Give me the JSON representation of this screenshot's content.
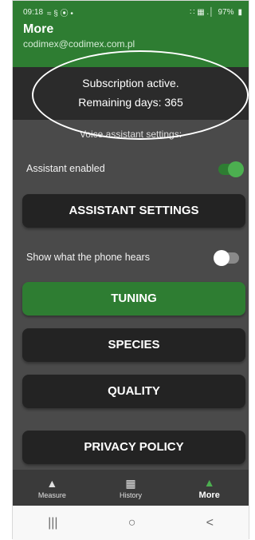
{
  "status_bar": {
    "time": "09:18",
    "left_icons": "≈ § ⦿ •",
    "right_icons": "∷ ▦ .│",
    "battery": "97%"
  },
  "header": {
    "title": "More",
    "email": "codimex@codimex.com.pl"
  },
  "subscription": {
    "line1": "Subscription active.",
    "line2": "Remaining days: 365"
  },
  "voice_section": {
    "label": "Voice assistant settings:",
    "assistant_enabled_label": "Assistant enabled",
    "assistant_enabled": true,
    "assistant_settings_button": "ASSISTANT SETTINGS",
    "show_hears_label": "Show what the phone hears",
    "show_hears": false
  },
  "buttons": {
    "tuning": "TUNING",
    "species": "SPECIES",
    "quality": "QUALITY",
    "privacy": "PRIVACY POLICY"
  },
  "bottom_nav": {
    "measure": "Measure",
    "history": "History",
    "more": "More"
  },
  "system_nav": {
    "recents": "|||",
    "home": "○",
    "back": "<"
  },
  "colors": {
    "accent": "#2e7d32",
    "toggle_on": "#4caf50",
    "background": "#4a4a4a",
    "button": "#232323"
  }
}
